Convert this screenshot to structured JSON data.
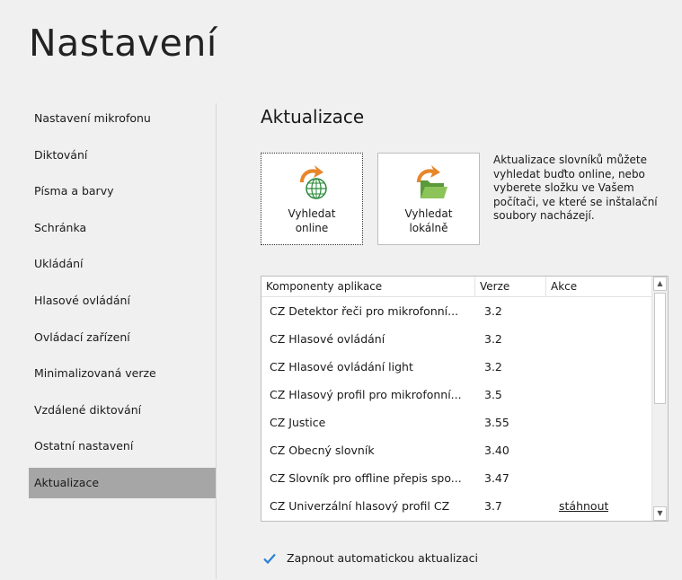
{
  "page": {
    "title": "Nastavení"
  },
  "sidebar": {
    "items": [
      {
        "label": "Nastavení mikrofonu"
      },
      {
        "label": "Diktování"
      },
      {
        "label": "Písma a barvy"
      },
      {
        "label": "Schránka"
      },
      {
        "label": "Ukládání"
      },
      {
        "label": "Hlasové ovládání"
      },
      {
        "label": "Ovládací zařízení"
      },
      {
        "label": "Minimalizovaná verze"
      },
      {
        "label": "Vzdálené diktování"
      },
      {
        "label": "Ostatní nastavení"
      },
      {
        "label": "Aktualizace",
        "active": true
      }
    ]
  },
  "section": {
    "title": "Aktualizace"
  },
  "buttons": {
    "online": {
      "label": "Vyhledat\nonline",
      "icon": "globe-update-icon"
    },
    "local": {
      "label": "Vyhledat\nlokálně",
      "icon": "folder-update-icon"
    }
  },
  "description": "Aktualizace slovníků můžete vyhledat buďto online, nebo vyberete složku ve Vašem počítači, ve které se inštalační soubory nacházejí.",
  "table": {
    "headers": [
      "Komponenty aplikace",
      "Verze",
      "Akce"
    ],
    "rows": [
      {
        "name": "CZ Detektor řeči pro mikrofonní...",
        "version": "3.2",
        "action": ""
      },
      {
        "name": "CZ Hlasové ovládání",
        "version": "3.2",
        "action": ""
      },
      {
        "name": "CZ Hlasové ovládání light",
        "version": "3.2",
        "action": ""
      },
      {
        "name": "CZ Hlasový profil pro mikrofonní...",
        "version": "3.5",
        "action": ""
      },
      {
        "name": "CZ Justice",
        "version": "3.55",
        "action": ""
      },
      {
        "name": "CZ Obecný slovník",
        "version": "3.40",
        "action": ""
      },
      {
        "name": "CZ Slovník pro offline přepis spo...",
        "version": "3.47",
        "action": ""
      },
      {
        "name": "CZ Univerzální hlasový profil CZ",
        "version": "3.7",
        "action": "stáhnout"
      }
    ]
  },
  "auto_update": {
    "label": "Zapnout automatickou aktualizaci",
    "checked": true
  },
  "colors": {
    "accent_blue": "#2a7fd4",
    "orange": "#e8862a",
    "active_bg": "#a6a6a6"
  }
}
